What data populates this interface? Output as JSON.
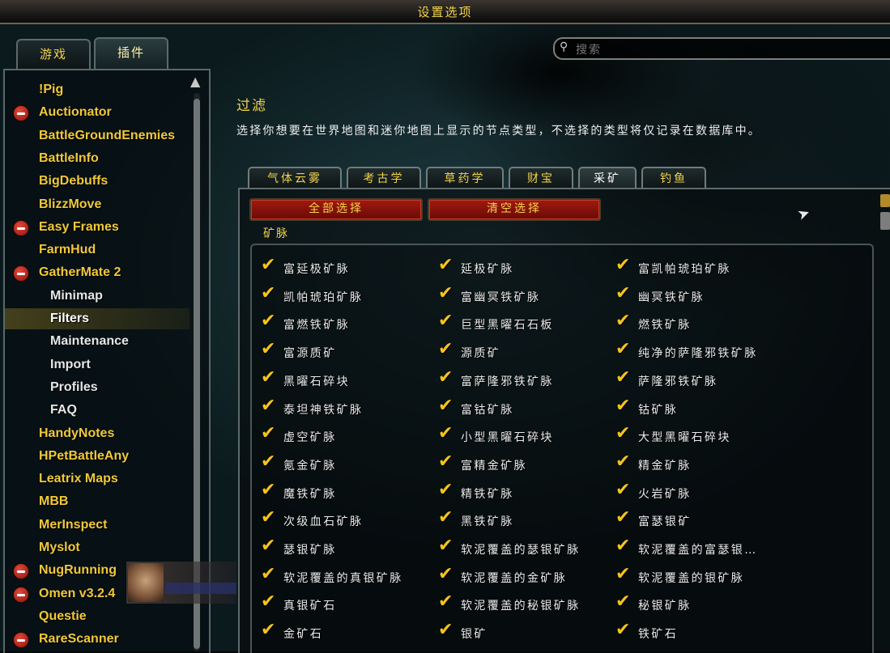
{
  "window": {
    "title": "设置选项"
  },
  "top_tabs": [
    {
      "label": "游戏",
      "active": false
    },
    {
      "label": "插件",
      "active": true
    }
  ],
  "search": {
    "placeholder": "搜索"
  },
  "sidebar": {
    "items": [
      {
        "label": "!Pig",
        "collapsible": false,
        "sub": false
      },
      {
        "label": "Auctionator",
        "collapsible": true,
        "sub": false
      },
      {
        "label": "BattleGroundEnemies",
        "collapsible": false,
        "sub": false
      },
      {
        "label": "BattleInfo",
        "collapsible": false,
        "sub": false
      },
      {
        "label": "BigDebuffs",
        "collapsible": false,
        "sub": false
      },
      {
        "label": "BlizzMove",
        "collapsible": false,
        "sub": false
      },
      {
        "label": "Easy Frames",
        "collapsible": true,
        "sub": false
      },
      {
        "label": "FarmHud",
        "collapsible": false,
        "sub": false
      },
      {
        "label": "GatherMate 2",
        "collapsible": true,
        "sub": false
      },
      {
        "label": "Minimap",
        "collapsible": false,
        "sub": true
      },
      {
        "label": "Filters",
        "collapsible": false,
        "sub": true,
        "selected": true
      },
      {
        "label": "Maintenance",
        "collapsible": false,
        "sub": true
      },
      {
        "label": "Import",
        "collapsible": false,
        "sub": true
      },
      {
        "label": "Profiles",
        "collapsible": false,
        "sub": true
      },
      {
        "label": "FAQ",
        "collapsible": false,
        "sub": true
      },
      {
        "label": "HandyNotes",
        "collapsible": false,
        "sub": false
      },
      {
        "label": "HPetBattleAny",
        "collapsible": false,
        "sub": false
      },
      {
        "label": "Leatrix Maps",
        "collapsible": false,
        "sub": false
      },
      {
        "label": "MBB",
        "collapsible": false,
        "sub": false
      },
      {
        "label": "MerInspect",
        "collapsible": false,
        "sub": false
      },
      {
        "label": "Myslot",
        "collapsible": false,
        "sub": false
      },
      {
        "label": "NugRunning",
        "collapsible": true,
        "sub": false
      },
      {
        "label": "Omen v3.2.4",
        "collapsible": true,
        "sub": false
      },
      {
        "label": "Questie",
        "collapsible": false,
        "sub": false
      },
      {
        "label": "RareScanner",
        "collapsible": true,
        "sub": false
      }
    ]
  },
  "main": {
    "heading": "过滤",
    "description": "选择你想要在世界地图和迷你地图上显示的节点类型，不选择的类型将仅记录在数据库中。",
    "filter_tabs": [
      {
        "label": "气体云雾",
        "active": false
      },
      {
        "label": "考古学",
        "active": false
      },
      {
        "label": "草药学",
        "active": false
      },
      {
        "label": "财宝",
        "active": false
      },
      {
        "label": "采矿",
        "active": true
      },
      {
        "label": "钓鱼",
        "active": false
      }
    ],
    "select_all_label": "全部选择",
    "clear_all_label": "清空选择",
    "group_label": "矿脉",
    "checkmark_glyph": "✔",
    "nodes": [
      "富延极矿脉",
      "延极矿脉",
      "富凯帕琥珀矿脉",
      "凯帕琥珀矿脉",
      "富幽冥铁矿脉",
      "幽冥铁矿脉",
      "富燃铁矿脉",
      "巨型黑曜石石板",
      "燃铁矿脉",
      "富源质矿",
      "源质矿",
      "纯净的萨隆邪铁矿脉",
      "黑曜石碎块",
      "富萨隆邪铁矿脉",
      "萨隆邪铁矿脉",
      "泰坦神铁矿脉",
      "富钴矿脉",
      "钴矿脉",
      "虚空矿脉",
      "小型黑曜石碎块",
      "大型黑曜石碎块",
      "氪金矿脉",
      "富精金矿脉",
      "精金矿脉",
      "魔铁矿脉",
      "精铁矿脉",
      "火岩矿脉",
      "次级血石矿脉",
      "黑铁矿脉",
      "富瑟银矿",
      "瑟银矿脉",
      "软泥覆盖的瑟银矿脉",
      "软泥覆盖的富瑟银…",
      "软泥覆盖的真银矿脉",
      "软泥覆盖的金矿脉",
      "软泥覆盖的银矿脉",
      "真银矿石",
      "软泥覆盖的秘银矿脉",
      "秘银矿脉",
      "金矿石",
      "银矿",
      "铁矿石"
    ]
  },
  "colors": {
    "accent": "#f2d34a",
    "check": "#f4c41a",
    "button": "#8a1208"
  }
}
